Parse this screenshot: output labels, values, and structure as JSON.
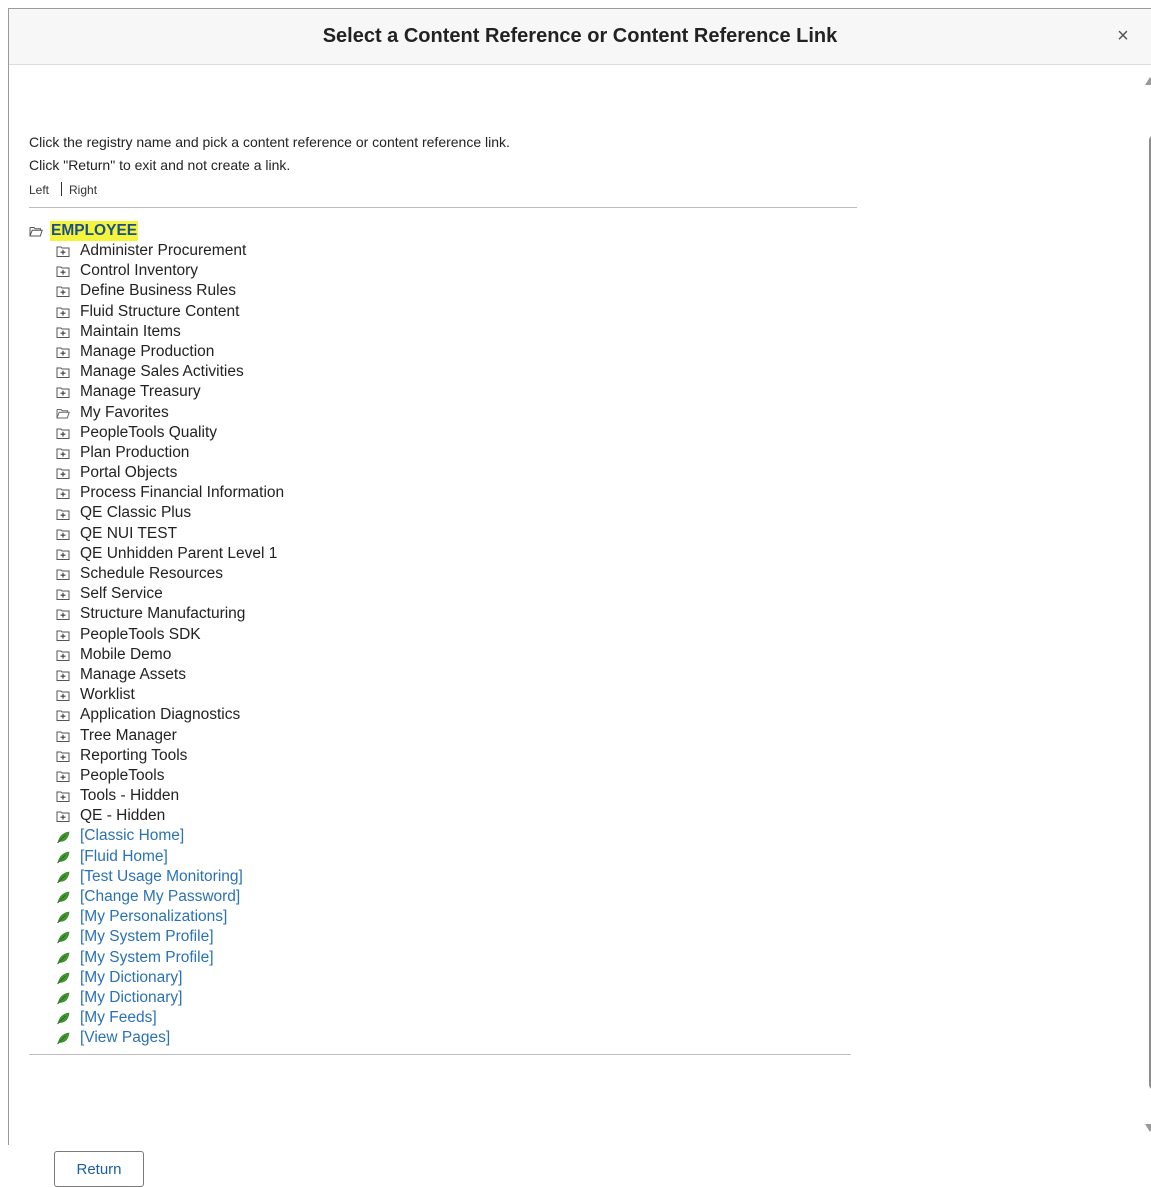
{
  "dialog": {
    "title": "Select a Content Reference or Content Reference Link",
    "close_label": "×"
  },
  "instructions": {
    "line1": "Click the registry name and pick a content reference or content reference link.",
    "line2": "Click \"Return\" to exit and not create a link."
  },
  "links": {
    "left": "Left",
    "right": "Right"
  },
  "tree": {
    "root_label": "EMPLOYEE",
    "items": [
      {
        "label": "Administer Procurement",
        "type": "folder-closed"
      },
      {
        "label": "Control Inventory",
        "type": "folder-closed"
      },
      {
        "label": "Define Business Rules",
        "type": "folder-closed"
      },
      {
        "label": "Fluid Structure Content",
        "type": "folder-closed"
      },
      {
        "label": "Maintain Items",
        "type": "folder-closed"
      },
      {
        "label": "Manage Production",
        "type": "folder-closed"
      },
      {
        "label": "Manage Sales Activities",
        "type": "folder-closed"
      },
      {
        "label": "Manage Treasury",
        "type": "folder-closed"
      },
      {
        "label": "My Favorites",
        "type": "folder-open"
      },
      {
        "label": "PeopleTools Quality",
        "type": "folder-closed"
      },
      {
        "label": "Plan Production",
        "type": "folder-closed"
      },
      {
        "label": "Portal Objects",
        "type": "folder-closed"
      },
      {
        "label": "Process Financial Information",
        "type": "folder-closed"
      },
      {
        "label": "QE Classic Plus",
        "type": "folder-closed"
      },
      {
        "label": "QE NUI TEST",
        "type": "folder-closed"
      },
      {
        "label": "QE Unhidden Parent Level 1",
        "type": "folder-closed"
      },
      {
        "label": "Schedule Resources",
        "type": "folder-closed"
      },
      {
        "label": "Self Service",
        "type": "folder-closed"
      },
      {
        "label": "Structure Manufacturing",
        "type": "folder-closed"
      },
      {
        "label": "PeopleTools SDK",
        "type": "folder-closed"
      },
      {
        "label": "Mobile Demo",
        "type": "folder-closed"
      },
      {
        "label": "Manage Assets",
        "type": "folder-closed"
      },
      {
        "label": "Worklist",
        "type": "folder-closed"
      },
      {
        "label": "Application Diagnostics",
        "type": "folder-closed"
      },
      {
        "label": "Tree Manager",
        "type": "folder-closed"
      },
      {
        "label": "Reporting Tools",
        "type": "folder-closed"
      },
      {
        "label": "PeopleTools",
        "type": "folder-closed"
      },
      {
        "label": "Tools - Hidden",
        "type": "folder-closed"
      },
      {
        "label": "QE - Hidden",
        "type": "folder-closed"
      },
      {
        "label": "[Classic Home]",
        "type": "leaf"
      },
      {
        "label": "[Fluid Home]",
        "type": "leaf"
      },
      {
        "label": "[Test Usage Monitoring]",
        "type": "leaf"
      },
      {
        "label": "[Change My Password]",
        "type": "leaf"
      },
      {
        "label": "[My Personalizations]",
        "type": "leaf"
      },
      {
        "label": "[My System Profile]",
        "type": "leaf"
      },
      {
        "label": "[My System Profile]",
        "type": "leaf"
      },
      {
        "label": "[My Dictionary]",
        "type": "leaf"
      },
      {
        "label": "[My Dictionary]",
        "type": "leaf"
      },
      {
        "label": "[My Feeds]",
        "type": "leaf"
      },
      {
        "label": "[View Pages]",
        "type": "leaf"
      }
    ]
  },
  "return_button": {
    "label": "Return"
  },
  "colors": {
    "link": "#2a72b5",
    "root_highlight": "#f4f43a",
    "leaf_icon": "#3f9a2e"
  },
  "icons": {
    "root": "folder-open-icon",
    "folder-closed": "folder-plus-icon",
    "folder-open": "folder-open-icon",
    "leaf": "leaf-icon",
    "close": "close-icon"
  }
}
